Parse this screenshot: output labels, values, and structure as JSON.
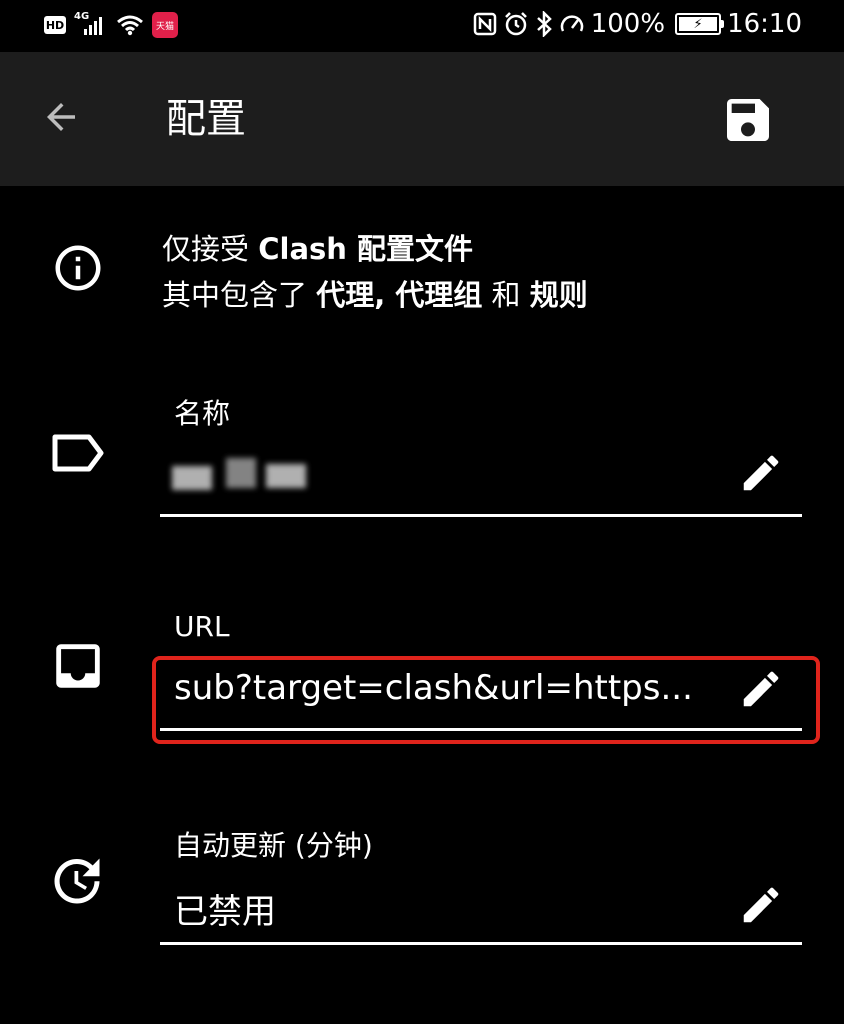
{
  "status_bar": {
    "hd": "HD",
    "network": "4G",
    "notif_app": "天猫",
    "battery_percent": "100%",
    "time": "16:10"
  },
  "app_bar": {
    "title": "配置"
  },
  "info": {
    "line1_prefix": "仅接受 ",
    "line1_bold": "Clash 配置文件",
    "line2_prefix": "其中包含了 ",
    "line2_bold1": "代理, 代理组",
    "line2_mid": " 和 ",
    "line2_bold2": "规则"
  },
  "fields": {
    "name": {
      "label": "名称",
      "value": ""
    },
    "url": {
      "label": "URL",
      "value": "sub?target=clash&url=https..."
    },
    "auto_update": {
      "label": "自动更新 (分钟)",
      "value": "已禁用"
    }
  },
  "icons": {
    "back": "arrow-back-icon",
    "save": "save-icon",
    "info": "info-icon",
    "name": "label-icon",
    "url": "inbox-icon",
    "auto_update": "update-icon",
    "edit": "pencil-icon"
  },
  "colors": {
    "background": "#000000",
    "app_bar": "#1d1d1d",
    "highlight": "#e0241c"
  }
}
